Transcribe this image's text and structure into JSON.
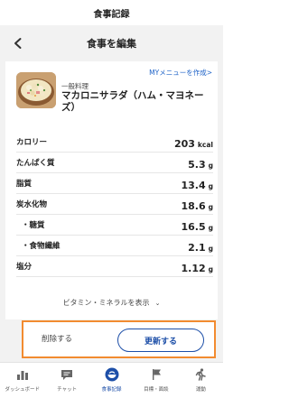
{
  "app": {
    "title": "食事記録"
  },
  "header": {
    "title": "食事を編集",
    "back_icon": "chevron-left-icon"
  },
  "food": {
    "my_menu_link": "MYメニューを作成>",
    "category": "一般料理",
    "name": "マカロニサラダ（ハム・マヨネーズ）"
  },
  "nutrients": [
    {
      "label": "カロリー",
      "value": "203",
      "unit": "kcal",
      "sub": false
    },
    {
      "label": "たんぱく質",
      "value": "5.3",
      "unit": "g",
      "sub": false
    },
    {
      "label": "脂質",
      "value": "13.4",
      "unit": "g",
      "sub": false
    },
    {
      "label": "炭水化物",
      "value": "18.6",
      "unit": "g",
      "sub": false
    },
    {
      "label": "・糖質",
      "value": "16.5",
      "unit": "g",
      "sub": true
    },
    {
      "label": "・食物繊維",
      "value": "2.1",
      "unit": "g",
      "sub": true
    },
    {
      "label": "塩分",
      "value": "1.12",
      "unit": "g",
      "sub": false
    }
  ],
  "show_vitamins": {
    "label": "ビタミン・ミネラルを表示",
    "icon": "chevron-down-icon"
  },
  "actions": {
    "delete_label": "削除する",
    "update_label": "更新する"
  },
  "colors": {
    "accent": "#1d4fa8",
    "highlight": "#f28b30",
    "link": "#1d62c7"
  },
  "nav": [
    {
      "label": "ダッシュボード",
      "icon": "bar-chart-icon",
      "active": false
    },
    {
      "label": "チャット",
      "icon": "chat-icon",
      "active": false
    },
    {
      "label": "食事記録",
      "icon": "meal-bowl-icon",
      "active": true
    },
    {
      "label": "目標・面談",
      "icon": "flag-icon",
      "active": false
    },
    {
      "label": "運動",
      "icon": "running-icon",
      "active": false
    }
  ]
}
